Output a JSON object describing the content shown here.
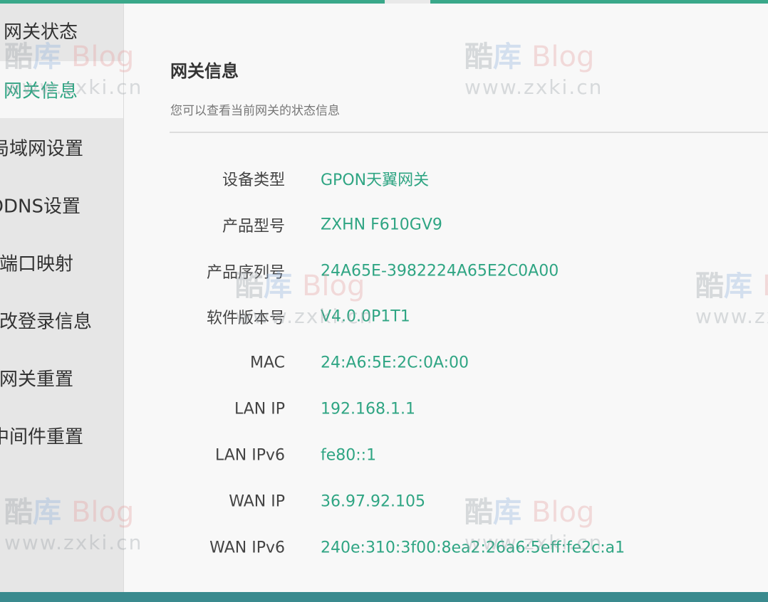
{
  "sidebar": {
    "items": [
      {
        "label": "网关状态",
        "active": false
      },
      {
        "label": "网关信息",
        "active": true
      },
      {
        "label": "局域网设置",
        "active": false
      },
      {
        "label": "DDNS设置",
        "active": false
      },
      {
        "label": "端口映射",
        "active": false
      },
      {
        "label": "改登录信息",
        "active": false
      },
      {
        "label": "网关重置",
        "active": false
      },
      {
        "label": "中间件重置",
        "active": false
      }
    ]
  },
  "main": {
    "title": "网关信息",
    "subtitle": "您可以查看当前网关的状态信息",
    "rows": [
      {
        "label": "设备类型",
        "value": "GPON天翼网关"
      },
      {
        "label": "产品型号",
        "value": "ZXHN F610GV9"
      },
      {
        "label": "产品序列号",
        "value": "24A65E-3982224A65E2C0A00"
      },
      {
        "label": "软件版本号",
        "value": "V4.0.0P1T1"
      },
      {
        "label": "MAC",
        "value": "24:A6:5E:2C:0A:00"
      },
      {
        "label": "LAN IP",
        "value": "192.168.1.1"
      },
      {
        "label": "LAN IPv6",
        "value": "fe80::1"
      },
      {
        "label": "WAN IP",
        "value": "36.97.92.105"
      },
      {
        "label": "WAN IPv6",
        "value": "240e:310:3f00:8ea2:26a6:5eff:fe2c:a1"
      }
    ]
  },
  "watermark": {
    "char1": "酷",
    "char2": "库",
    "brand": "Blog",
    "url": "www.zxki.cn"
  },
  "colors": {
    "accent": "#2fa583",
    "top_bar": "#3aa88a",
    "bottom_bar": "#3a8a8e"
  }
}
